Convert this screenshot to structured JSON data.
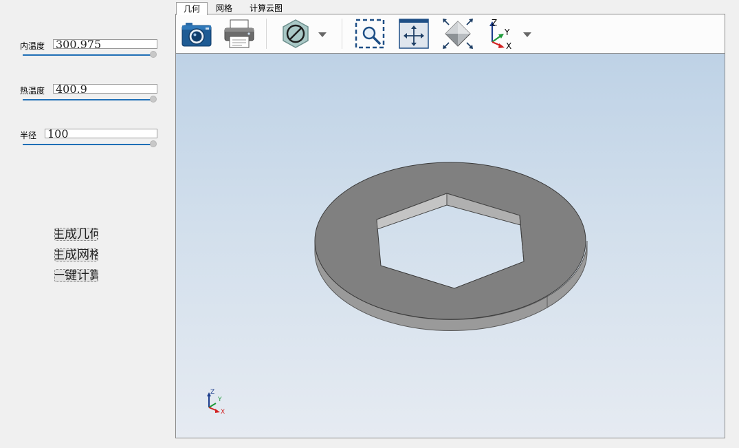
{
  "params": {
    "inner_temp": {
      "label": "内温度",
      "value": "300.975",
      "slider_value": 1.0
    },
    "hot_temp": {
      "label": "热温度",
      "value": "400.9",
      "slider_value": 1.0
    },
    "radius": {
      "label": "半径",
      "value": "100",
      "slider_value": 1.0
    }
  },
  "actions": {
    "generate_geometry": "生成几何",
    "generate_mesh": "生成网格",
    "one_click_compute": "一键计算"
  },
  "tabs": [
    "几何",
    "网格",
    "计算云图"
  ],
  "active_tab": "几何",
  "toolbar": {
    "icons": [
      "camera-icon",
      "printer-icon",
      "no-entry-icon",
      "zoom-box-icon",
      "pan-fit-icon",
      "fit-all-icon",
      "axes-icon"
    ]
  },
  "axis_labels": {
    "z": "Z",
    "y": "Y",
    "x": "X"
  },
  "colors": {
    "slider_track": "#1f6fb6",
    "model_gray": "#808080",
    "background_top": "#bed2e6",
    "background_bottom": "#e6ebf2"
  }
}
